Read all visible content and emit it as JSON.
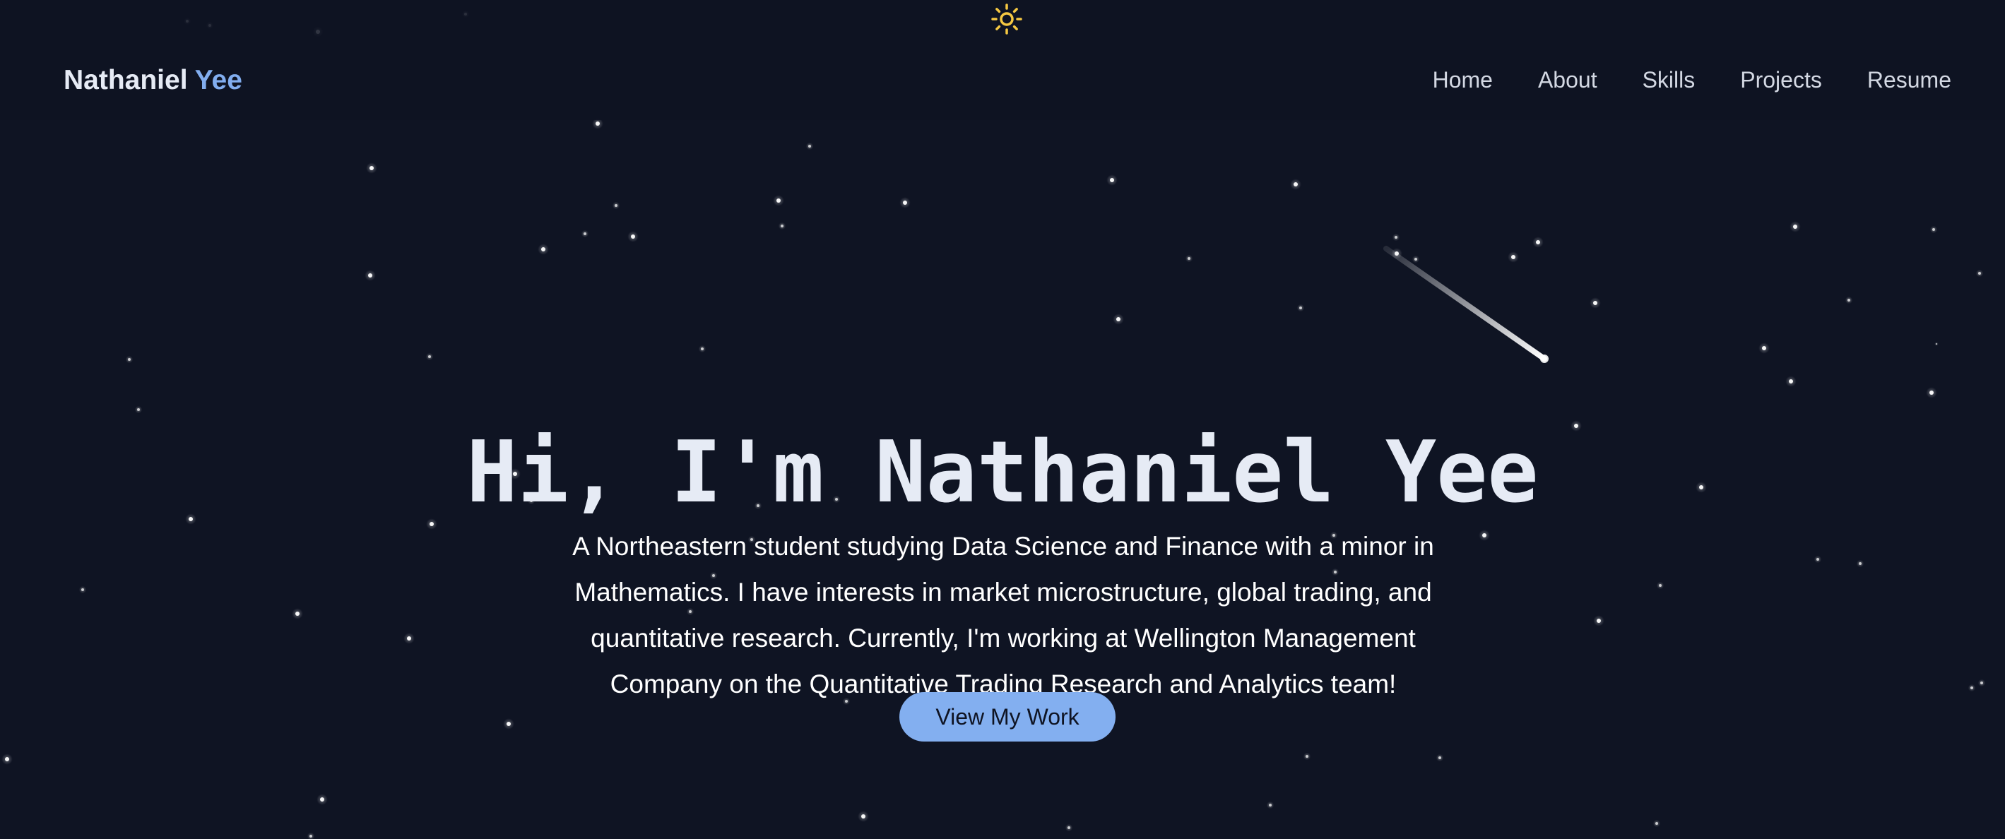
{
  "brand": {
    "first": "Nathaniel",
    "last": "Yee"
  },
  "nav": {
    "items": [
      "Home",
      "About",
      "Skills",
      "Projects",
      "Resume"
    ]
  },
  "theme_toggle": {
    "icon": "sun-icon",
    "color": "#f5c842"
  },
  "hero": {
    "title": "Hi, I'm Nathaniel Yee",
    "description": "A Northeastern student studying Data Science and Finance with a minor in Mathematics. I have interests in market microstructure, global trading, and quantitative research. Currently, I'm working at Wellington Management Company on the Quantitative Trading Research and Analytics team!",
    "cta": "View My Work"
  },
  "colors": {
    "background": "#0f1423",
    "accent": "#82aef0",
    "text": "#e6ebf5"
  }
}
